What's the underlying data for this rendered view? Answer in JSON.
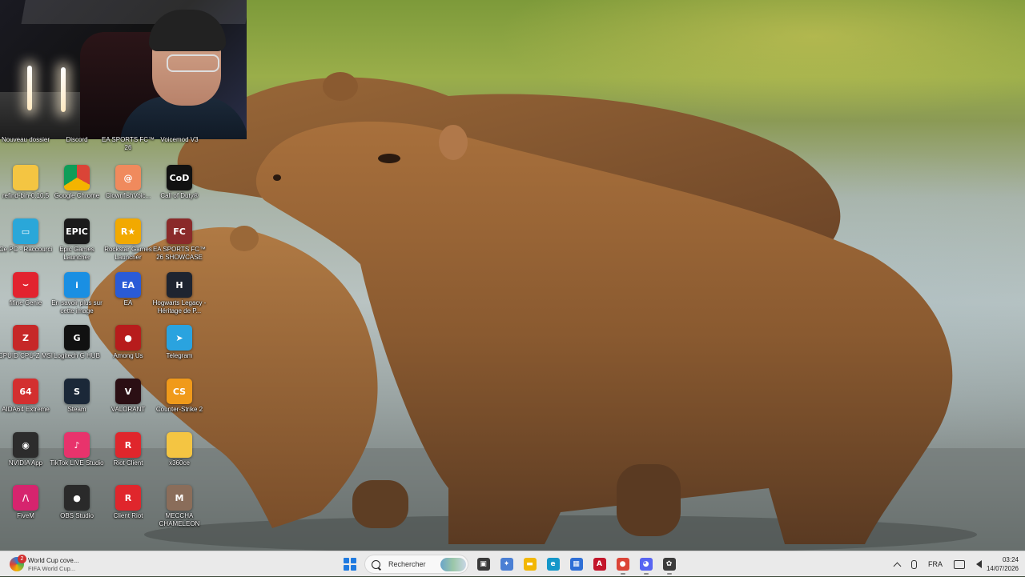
{
  "desktop": {
    "icons": [
      {
        "id": "nouveau-dossier",
        "label": "Nouveau dossier",
        "glyph": "",
        "bg": ""
      },
      {
        "id": "discord",
        "label": "Discord",
        "glyph": "",
        "bg": ""
      },
      {
        "id": "ea-sports-fc-26",
        "label": "EA SPORTS FC™ 26",
        "glyph": "",
        "bg": ""
      },
      {
        "id": "voicemod",
        "label": "Voicemod V3",
        "glyph": "",
        "bg": ""
      },
      {
        "id": "refind-bin",
        "label": "refind-bin-0.10.5",
        "glyph": "",
        "bg": "#f4c542"
      },
      {
        "id": "google-chrome",
        "label": "Google Chrome",
        "glyph": "",
        "bg": "conic-gradient(#db4437 0 33%,#f4b400 0 66%,#0f9d58 0)"
      },
      {
        "id": "clownfish",
        "label": "ClownfishVoic...",
        "glyph": "@",
        "bg": "#f08a5d"
      },
      {
        "id": "call-of-duty",
        "label": "Call of Duty®",
        "glyph": "CoD",
        "bg": "#111111"
      },
      {
        "id": "ce-pc",
        "label": "Ce PC - Raccourci",
        "glyph": "▭",
        "bg": "#2aa7d9"
      },
      {
        "id": "epic-games",
        "label": "Epic Games Launcher",
        "glyph": "EPIC",
        "bg": "#1b1b1b"
      },
      {
        "id": "rockstar",
        "label": "Rockstar Games Launcher",
        "glyph": "R★",
        "bg": "#f2a900"
      },
      {
        "id": "ea-fc-26-showcase",
        "label": "EA SPORTS FC™ 26 SHOWCASE",
        "glyph": "FC",
        "bg": "#8a2a2a"
      },
      {
        "id": "fifine",
        "label": "fifine Genie",
        "glyph": "⌣",
        "bg": "#e2232f"
      },
      {
        "id": "en-savoir-plus",
        "label": "En savoir plus sur cette image",
        "glyph": "i",
        "bg": "#1a8fe3"
      },
      {
        "id": "ea",
        "label": "EA",
        "glyph": "EA",
        "bg": "#2a5bd7"
      },
      {
        "id": "hogwarts",
        "label": "Hogwarts Legacy - Héritage de P...",
        "glyph": "H",
        "bg": "#1e2430"
      },
      {
        "id": "cpuid",
        "label": "CPUID CPU-Z MSI",
        "glyph": "Z",
        "bg": "#c62828"
      },
      {
        "id": "logitech",
        "label": "Logitech G HUB",
        "glyph": "G",
        "bg": "#111111"
      },
      {
        "id": "among-us",
        "label": "Among Us",
        "glyph": "●",
        "bg": "#b71c1c"
      },
      {
        "id": "telegram",
        "label": "Telegram",
        "glyph": "➤",
        "bg": "#2aa3df"
      },
      {
        "id": "aida64",
        "label": "AIDA64 Extreme",
        "glyph": "64",
        "bg": "#d32f2f"
      },
      {
        "id": "steam",
        "label": "Steam",
        "glyph": "S",
        "bg": "#1b2838"
      },
      {
        "id": "valorant",
        "label": "VALORANT",
        "glyph": "V",
        "bg": "#2b0f14"
      },
      {
        "id": "counter-strike",
        "label": "Counter-Strike 2",
        "glyph": "CS",
        "bg": "#f09a1a"
      },
      {
        "id": "nvidia",
        "label": "NVIDIA App",
        "glyph": "◉",
        "bg": "#2c2c2c"
      },
      {
        "id": "tiktok",
        "label": "TikTok LIVE Studio",
        "glyph": "♪",
        "bg": "#e8336c"
      },
      {
        "id": "riot-client",
        "label": "Riot Client",
        "glyph": "R",
        "bg": "#e0262c"
      },
      {
        "id": "x360ce",
        "label": "x360ce",
        "glyph": "",
        "bg": "#f4c542"
      },
      {
        "id": "fivem",
        "label": "FiveM",
        "glyph": "/\\",
        "bg": "#d6246e"
      },
      {
        "id": "obs",
        "label": "OBS Studio",
        "glyph": "●",
        "bg": "#2a2a2a"
      },
      {
        "id": "client-riot",
        "label": "Client Riot",
        "glyph": "R",
        "bg": "#e0262c"
      },
      {
        "id": "mecha-chameleon",
        "label": "MECCHA CHAMELEON",
        "glyph": "M",
        "bg": "#8a6d5a"
      }
    ]
  },
  "taskbar": {
    "news": {
      "badge": "2",
      "title": "World Cup cove...",
      "subtitle": "FIFA World Cup..."
    },
    "search": {
      "placeholder": "Rechercher"
    },
    "apps": [
      {
        "id": "task-view",
        "glyph": "▣",
        "bg": "#3a3a3a",
        "active": false
      },
      {
        "id": "widgets",
        "glyph": "✦",
        "bg": "#4a7fd4",
        "active": false
      },
      {
        "id": "file-explorer",
        "glyph": "▬",
        "bg": "#f2b705",
        "active": false
      },
      {
        "id": "edge",
        "glyph": "e",
        "bg": "#1597c9",
        "active": false
      },
      {
        "id": "store",
        "glyph": "▦",
        "bg": "#2f6fd6",
        "active": false
      },
      {
        "id": "adobe",
        "glyph": "A",
        "bg": "#c3162b",
        "active": false
      },
      {
        "id": "chrome",
        "glyph": "●",
        "bg": "#db4437",
        "active": true
      },
      {
        "id": "discord",
        "glyph": "◕",
        "bg": "#5865f2",
        "active": true
      },
      {
        "id": "davinci",
        "glyph": "✿",
        "bg": "#3c3c3c",
        "active": true
      }
    ],
    "tray": {
      "language": "FRA"
    },
    "clock": {
      "time": "03:24",
      "date": "14/07/2026"
    }
  }
}
